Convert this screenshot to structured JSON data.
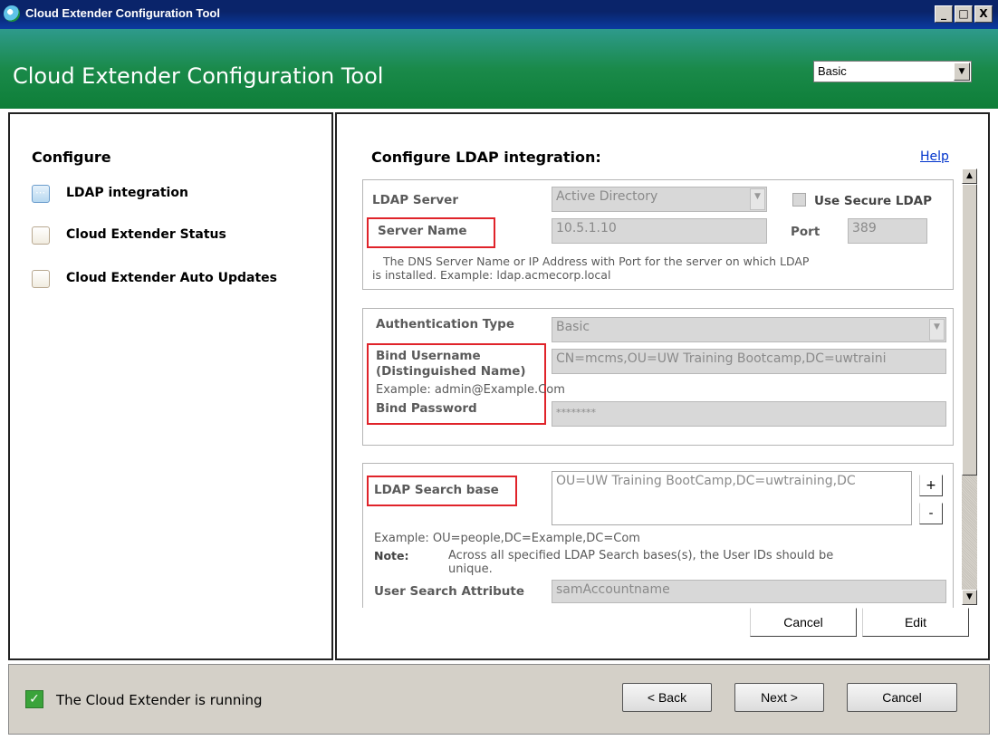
{
  "window": {
    "title": "Cloud Extender Configuration Tool",
    "min_label": "_",
    "max_label": "□",
    "close_label": "X"
  },
  "header": {
    "title": "Cloud Extender Configuration Tool",
    "mode_select": "Basic"
  },
  "sidebar": {
    "title": "Configure",
    "items": [
      {
        "label": "LDAP integration",
        "active": true
      },
      {
        "label": "Cloud Extender Status",
        "active": false
      },
      {
        "label": "Cloud Extender Auto Updates",
        "active": false
      }
    ]
  },
  "main": {
    "title": "Configure LDAP integration:",
    "help_label": "Help",
    "server": {
      "ldap_server_label": "LDAP Server",
      "ldap_server_value": "Active Directory",
      "secure_label": "Use Secure LDAP",
      "server_name_label": "Server Name",
      "server_name_value": "10.5.1.10",
      "port_label": "Port",
      "port_value": "389",
      "hint_line1": "The DNS Server Name or IP Address with Port for the server on which LDAP",
      "hint_line2": "is installed. Example: ldap.acmecorp.local"
    },
    "auth": {
      "auth_type_label": "Authentication Type",
      "auth_type_value": "Basic",
      "bind_username_label1": "Bind Username",
      "bind_username_label2": "(Distinguished Name)",
      "bind_username_value": "CN=mcms,OU=UW Training Bootcamp,DC=uwtraini",
      "example": "Example: admin@Example.Com",
      "bind_password_label": "Bind Password",
      "bind_password_value": "********"
    },
    "search": {
      "search_base_label": "LDAP Search base",
      "search_base_value": "OU=UW Training BootCamp,DC=uwtraining,DC",
      "plus_label": "+",
      "minus_label": "-",
      "example": "Example: OU=people,DC=Example,DC=Com",
      "note_label": "Note:",
      "note_line1": "Across all specified LDAP Search bases(s), the User IDs should be",
      "note_line2": "unique.",
      "user_attr_label": "User Search Attribute",
      "user_attr_value": "samAccountname"
    },
    "cancel_label": "Cancel",
    "edit_label": "Edit"
  },
  "status": {
    "text": "The Cloud Extender is running",
    "back_label": "< Back",
    "next_label": "Next >",
    "cancel_label": "Cancel"
  }
}
